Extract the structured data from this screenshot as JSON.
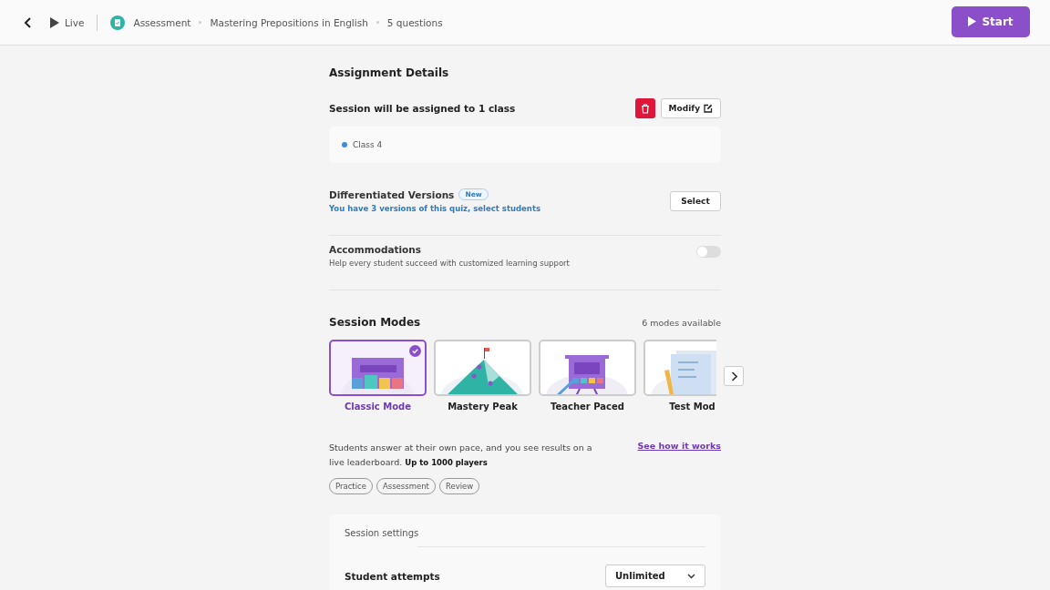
{
  "header": {
    "live_label": "Live",
    "breadcrumb": [
      "Assessment",
      "Mastering Prepositions in English",
      "5 questions"
    ],
    "start_button": "Start"
  },
  "assignment": {
    "title": "Assignment Details",
    "assigned_text": "Session will be assigned to 1 class",
    "modify_button": "Modify",
    "classes": [
      {
        "name": "Class 4",
        "color": "#3b8fd9"
      }
    ]
  },
  "differentiated": {
    "title": "Differentiated Versions",
    "badge": "New",
    "link": "You have 3 versions of this quiz, select students",
    "button": "Select"
  },
  "accommodations": {
    "title": "Accommodations",
    "description": "Help every student succeed with customized learning support",
    "on": false
  },
  "session_modes": {
    "title": "Session Modes",
    "count": "6 modes available",
    "modes": [
      {
        "label": "Classic Mode",
        "kind": "classic",
        "selected": true
      },
      {
        "label": "Mastery Peak",
        "kind": "peak",
        "selected": false
      },
      {
        "label": "Teacher Paced",
        "kind": "paced",
        "selected": false
      },
      {
        "label": "Test Mod",
        "kind": "test",
        "selected": false
      }
    ],
    "description": "Students answer at their own pace, and you see results on a live leaderboard. **Up to 1000 players**",
    "link": "See how it works",
    "tags": [
      "Practice",
      "Assessment",
      "Review"
    ]
  },
  "session_settings": {
    "title": "Session settings",
    "rows": [
      {
        "label": "Student attempts",
        "value": "Unlimited"
      }
    ]
  }
}
